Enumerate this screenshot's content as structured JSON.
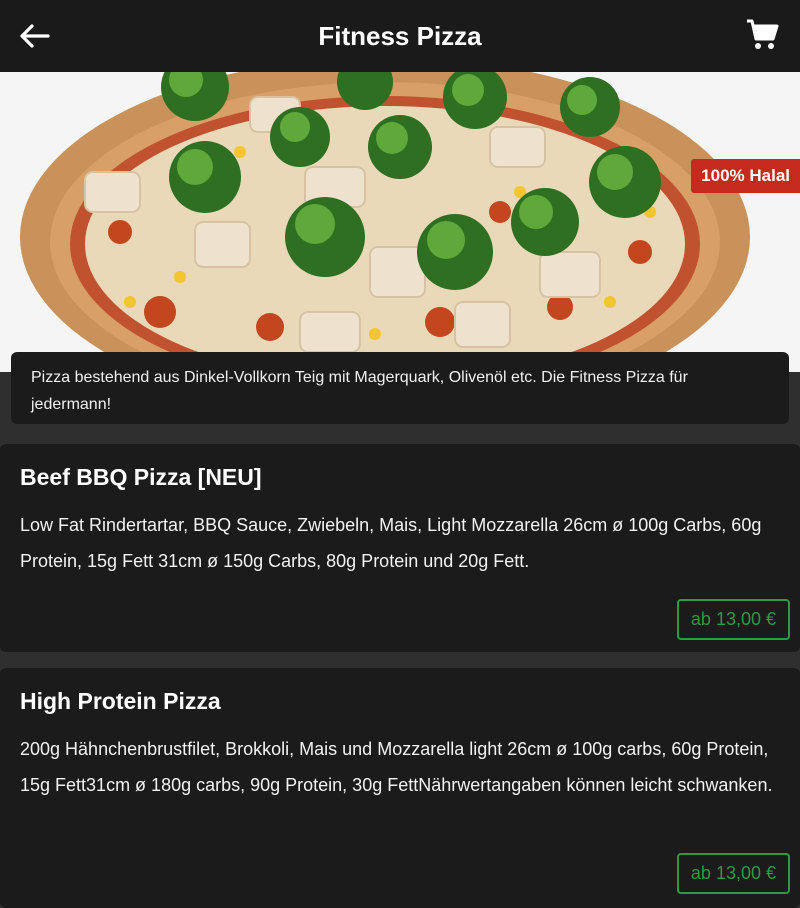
{
  "header": {
    "title": "Fitness Pizza",
    "back_icon": "arrow-left-icon",
    "cart_icon": "shopping-cart-icon"
  },
  "hero": {
    "badge": "100% Halal"
  },
  "category": {
    "description": "Pizza bestehend aus Dinkel-Vollkorn Teig mit Magerquark, Olivenöl etc. Die Fitness Pizza für jedermann!"
  },
  "products": [
    {
      "name": "Beef BBQ Pizza [NEU]",
      "description": "Low Fat Rindertartar, BBQ Sauce, Zwiebeln, Mais, Light Mozzarella 26cm ø 100g Carbs, 60g Protein, 15g Fett 31cm ø 150g Carbs, 80g Protein und 20g Fett.",
      "price": "ab 13,00 €"
    },
    {
      "name": "High Protein Pizza",
      "description": "200g Hähnchenbrustfilet, Brokkoli, Mais und Mozzarella light 26cm ø 100g carbs, 60g Protein, 15g Fett31cm ø 180g carbs, 90g Protein, 30g FettNährwertangaben können leicht schwanken.",
      "price": "ab 13,00 €"
    }
  ],
  "colors": {
    "header_bg": "#1a1a1a",
    "card_bg": "#1b1b1b",
    "badge_red": "#c62a1d",
    "price_green": "#2f9a44"
  }
}
